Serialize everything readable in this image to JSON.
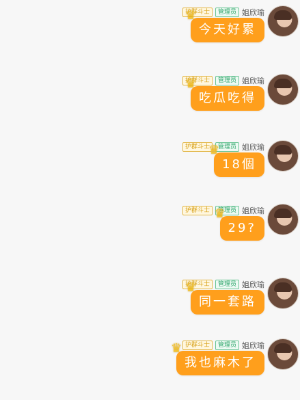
{
  "messages": [
    {
      "username": "姐欣瑜",
      "badges": {
        "admin": "管理员",
        "guard": "护群斗士"
      },
      "text": "今天好累"
    },
    {
      "username": "姐欣瑜",
      "badges": {
        "admin": "管理员",
        "guard": "护群斗士"
      },
      "text": "吃瓜吃得"
    },
    {
      "username": "姐欣瑜",
      "badges": {
        "admin": "管理员",
        "guard": "护群斗士"
      },
      "text": "18個"
    },
    {
      "username": "姐欣瑜",
      "badges": {
        "admin": "管理员",
        "guard": "护群斗士"
      },
      "text": "29?"
    },
    {
      "username": "姐欣瑜",
      "badges": {
        "admin": "管理员",
        "guard": "护群斗士"
      },
      "text": "同一套路"
    },
    {
      "username": "姐欣瑜",
      "badges": {
        "admin": "管理员",
        "guard": "护群斗士"
      },
      "text": "我也麻木了"
    }
  ],
  "colors": {
    "bubble": "#ff9f1c",
    "background": "#f7f7f7",
    "admin_badge": "#2ea56b",
    "guard_badge": "#d8a21a"
  },
  "icons": {
    "crown": "crown-icon",
    "avatar": "avatar"
  }
}
